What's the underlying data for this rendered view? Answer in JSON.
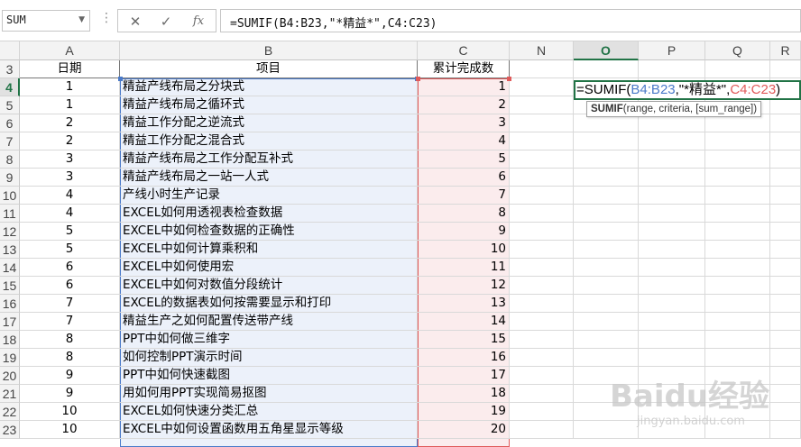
{
  "formula_bar": {
    "name_box": "SUM",
    "dots": "⋮",
    "cancel_icon": "✕",
    "enter_icon": "✓",
    "fx_label": "fx",
    "formula": "=SUMIF(B4:B23,\"*精益*\",C4:C23)"
  },
  "columns": {
    "A": "A",
    "B": "B",
    "C": "C",
    "N": "N",
    "O": "O",
    "P": "P",
    "Q": "Q",
    "R": "R"
  },
  "header_row": {
    "row_num": "3",
    "date_label": "日期",
    "project_label": "项目",
    "count_label": "累计完成数"
  },
  "rows": [
    {
      "r": "4",
      "a": "1",
      "b": "精益产线布局之分块式",
      "c": "1"
    },
    {
      "r": "5",
      "a": "1",
      "b": "精益产线布局之循环式",
      "c": "2"
    },
    {
      "r": "6",
      "a": "2",
      "b": "精益工作分配之逆流式",
      "c": "3"
    },
    {
      "r": "7",
      "a": "2",
      "b": "精益工作分配之混合式",
      "c": "4"
    },
    {
      "r": "8",
      "a": "3",
      "b": "精益产线布局之工作分配互补式",
      "c": "5"
    },
    {
      "r": "9",
      "a": "3",
      "b": "精益产线布局之一站一人式",
      "c": "6"
    },
    {
      "r": "10",
      "a": "4",
      "b": "产线小时生产记录",
      "c": "7"
    },
    {
      "r": "11",
      "a": "4",
      "b": "EXCEL如何用透视表检查数据",
      "c": "8"
    },
    {
      "r": "12",
      "a": "5",
      "b": "EXCEL中如何检查数据的正确性",
      "c": "9"
    },
    {
      "r": "13",
      "a": "5",
      "b": "EXCEL中如何计算乘积和",
      "c": "10"
    },
    {
      "r": "14",
      "a": "6",
      "b": "EXCEL中如何使用宏",
      "c": "11"
    },
    {
      "r": "15",
      "a": "6",
      "b": "EXCEL中如何对数值分段统计",
      "c": "12"
    },
    {
      "r": "16",
      "a": "7",
      "b": "EXCEL的数据表如何按需要显示和打印",
      "c": "13"
    },
    {
      "r": "17",
      "a": "7",
      "b": "精益生产之如何配置传送带产线",
      "c": "14"
    },
    {
      "r": "18",
      "a": "8",
      "b": "PPT中如何做三维字",
      "c": "15"
    },
    {
      "r": "19",
      "a": "8",
      "b": "如何控制PPT演示时间",
      "c": "16"
    },
    {
      "r": "20",
      "a": "9",
      "b": "PPT中如何快速截图",
      "c": "17"
    },
    {
      "r": "21",
      "a": "9",
      "b": "用如何用PPT实现简易抠图",
      "c": "18"
    },
    {
      "r": "22",
      "a": "10",
      "b": "EXCEL如何快速分类汇总",
      "c": "19"
    },
    {
      "r": "23",
      "a": "10",
      "b": "EXCEL中如何设置函数用五角星显示等级",
      "c": "20"
    }
  ],
  "active_cell": {
    "prefix": "=SUMIF(",
    "ref1": "B4:B23",
    "middle": ",\"*精益*\",",
    "ref2": "C4:C23",
    "suffix": ")"
  },
  "tooltip": {
    "func": "SUMIF",
    "args": "(range, criteria, [sum_range])"
  },
  "watermark": {
    "main": "Baidu经验",
    "sub": "jingyan.baidu.com"
  },
  "colors": {
    "accent": "#217346",
    "range_b": "#4a7ac9",
    "range_c": "#e05a5a"
  }
}
